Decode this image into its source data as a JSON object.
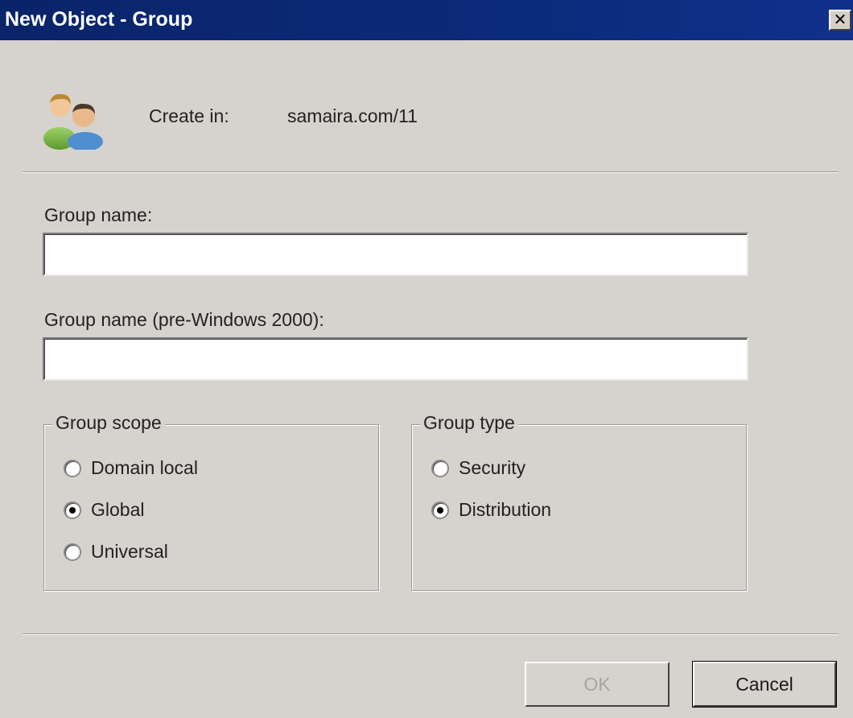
{
  "window": {
    "title": "New Object - Group",
    "close_glyph": "✕"
  },
  "header": {
    "icon": "group-users-icon",
    "create_in_label": "Create in:",
    "create_in_value": "samaira.com/11"
  },
  "fields": {
    "group_name_label": "Group name:",
    "group_name_value": "",
    "group_name_pre2000_label": "Group name (pre-Windows 2000):",
    "group_name_pre2000_value": ""
  },
  "group_scope": {
    "legend": "Group scope",
    "options": [
      "Domain local",
      "Global",
      "Universal"
    ],
    "selected": "Global"
  },
  "group_type": {
    "legend": "Group type",
    "options": [
      "Security",
      "Distribution"
    ],
    "selected": "Distribution"
  },
  "buttons": {
    "ok": "OK",
    "ok_enabled": false,
    "cancel": "Cancel"
  }
}
